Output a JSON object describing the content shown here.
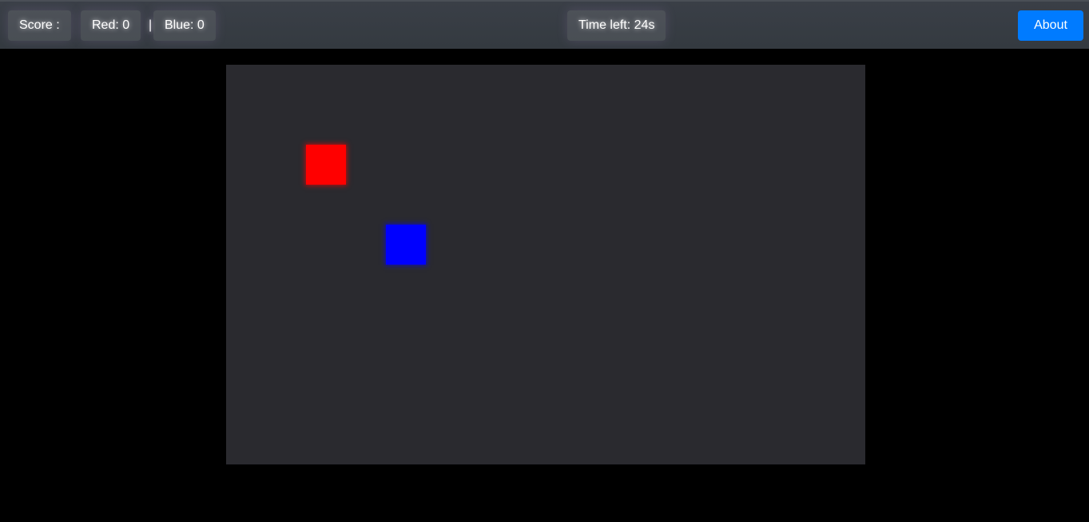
{
  "scoreboard": {
    "score_label": "Score :",
    "red_label": "Red: 0",
    "separator": "|",
    "blue_label": "Blue: 0",
    "timer_label": "Time left: 24s"
  },
  "nav": {
    "about_label": "About"
  },
  "game": {
    "players": [
      {
        "name": "red",
        "color": "#ff0000"
      },
      {
        "name": "blue",
        "color": "#0000ff"
      }
    ],
    "arena_color": "#2a2a2f"
  },
  "colors": {
    "topbar": "#343a40",
    "accent": "#007bff",
    "background": "#000000"
  }
}
